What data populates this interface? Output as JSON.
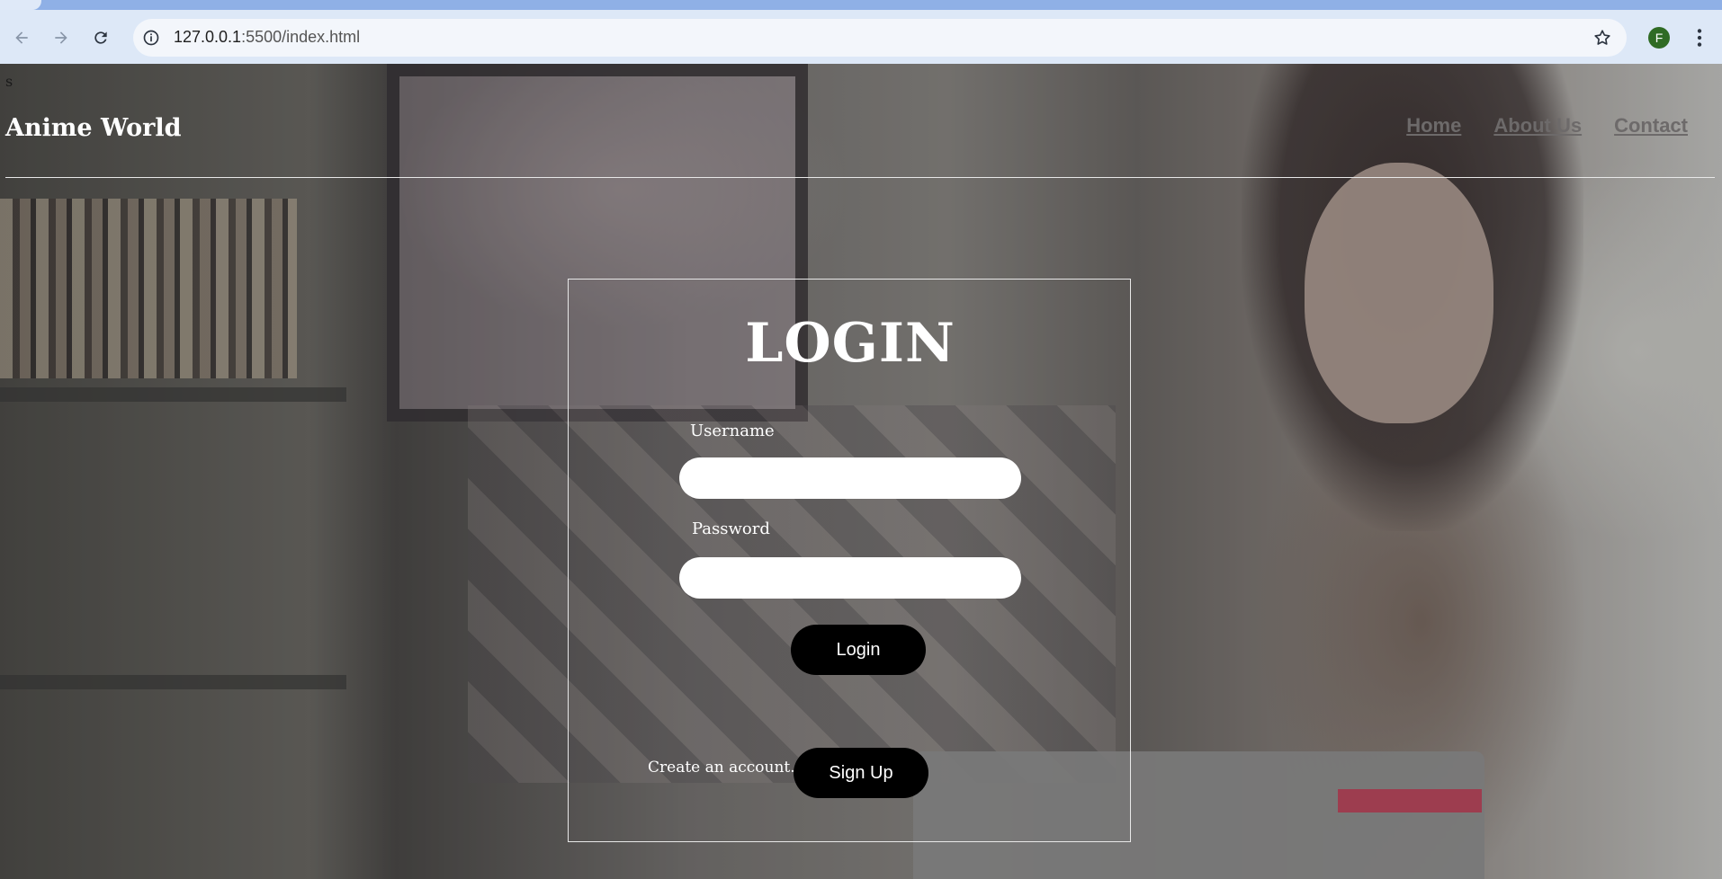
{
  "browser": {
    "url_host": "127.0.0.1",
    "url_path": ":5500/index.html",
    "profile_initial": "F",
    "icons": {
      "back": "back-arrow-icon",
      "forward": "forward-arrow-icon",
      "reload": "reload-icon",
      "site_info": "info-icon",
      "bookmark": "star-icon",
      "menu": "kebab-menu-icon"
    }
  },
  "page": {
    "stray_text": "s",
    "brand": "Anime World",
    "nav": [
      {
        "label": "Home"
      },
      {
        "label": "About Us"
      },
      {
        "label": "Contact"
      }
    ]
  },
  "login": {
    "title": "LOGIN",
    "username_label": "Username",
    "username_value": "",
    "password_label": "Password",
    "password_value": "",
    "login_button": "Login",
    "create_account_text": "Create an account.",
    "signup_button": "Sign Up"
  },
  "colors": {
    "tab_strip": "#8fb0e6",
    "toolbar": "#dde8f7",
    "profile_avatar": "#2f6b24",
    "button_bg": "#000000",
    "nav_link": "#6d6a6a"
  }
}
